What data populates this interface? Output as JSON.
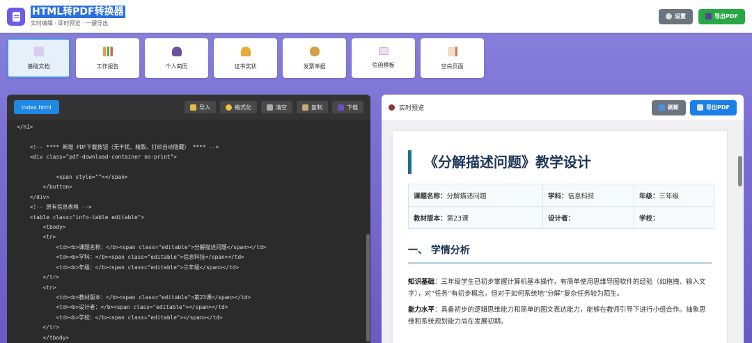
{
  "header": {
    "title": "HTML转PDF转换器",
    "subtitle": "实时编辑 · 即时预览 · 一键导出",
    "settings_label": "设置",
    "export_label": "导出PDF"
  },
  "templates": [
    {
      "label": "基础文档",
      "icon": "document-icon",
      "color": "#c9b8e8"
    },
    {
      "label": "工作报告",
      "icon": "bar-chart-icon",
      "color": "#e89c4a"
    },
    {
      "label": "个人简历",
      "icon": "person-icon",
      "color": "#6b4fa0"
    },
    {
      "label": "证书奖状",
      "icon": "trophy-icon",
      "color": "#e8a935"
    },
    {
      "label": "发票单据",
      "icon": "money-bag-icon",
      "color": "#d4a046"
    },
    {
      "label": "信函模板",
      "icon": "envelope-icon",
      "color": "#e8d8f0"
    },
    {
      "label": "空白页面",
      "icon": "memo-icon",
      "color": "#e0a070"
    }
  ],
  "editor": {
    "tab": "index.html",
    "tools": {
      "import": "导入",
      "format": "格式化",
      "clear": "清空",
      "copy": "复制",
      "download": "下载"
    },
    "code": [
      "</h1>",
      "",
      "    <!-- **** 新增 PDF下载按钮（无干扰、精致、打印自动隐藏） **** -->",
      "    <div class=\"pdf-download-container no-print\">",
      "",
      "            <span style=\"\"></span>",
      "        </button>",
      "    </div>",
      "    <!-- 原有信息表格 -->",
      "    <table class=\"info-table editable\">",
      "        <tbody>",
      "        <tr>",
      "            <td><b>课题名称：</b><span class=\"editable\">分解描述问题</span></td>",
      "            <td><b>学科：</b><span class=\"editable\">信息科技</span></td>",
      "            <td><b>年级：</b><span class=\"editable\">三年级</span></td>",
      "        </tr>",
      "        <tr>",
      "            <td><b>教材版本：</b><span class=\"editable\">第23课</span></td>",
      "            <td><b>设计者：</b><span class=\"editable\"></span></td>",
      "            <td><b>学校：</b><span class=\"editable\"></span></td>",
      "        </tr>",
      "        </tbody>"
    ]
  },
  "preview": {
    "title": "实时预览",
    "refresh_label": "刷新",
    "export_label": "导出PDF",
    "doc_title": "《分解描述问题》教学设计",
    "info": [
      [
        {
          "key": "课题名称：",
          "value": "分解描述问题"
        },
        {
          "key": "学科：",
          "value": "信息科技"
        },
        {
          "key": "年级：",
          "value": "三年级"
        }
      ],
      [
        {
          "key": "教材版本：",
          "value": "第23课"
        },
        {
          "key": "设计者：",
          "value": ""
        },
        {
          "key": "学校：",
          "value": ""
        }
      ]
    ],
    "section_title": "一、 学情分析",
    "paragraphs": [
      {
        "key": "知识基础",
        "text": "：三年级学生已初步掌握计算机基本操作，有简单使用思维导图软件的经验（如拖拽、输入文字），对“任务”有初步概念，但对于如何系统地“分解”复杂任务较为陌生。"
      },
      {
        "key": "能力水平",
        "text": "：具备初步的逻辑思维能力和简单的图文表达能力，能够在教师引导下进行小组合作。抽象思维和系统规划能力尚在发展初期。"
      }
    ]
  }
}
